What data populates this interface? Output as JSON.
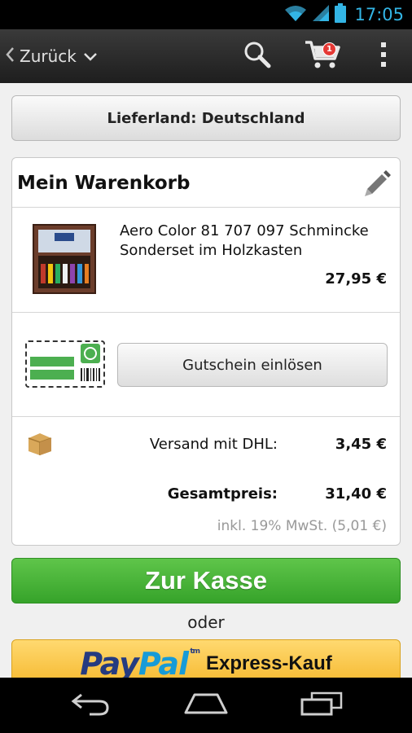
{
  "status_bar": {
    "time": "17:05"
  },
  "action_bar": {
    "back_label": "Zurück",
    "cart_count": "1"
  },
  "country": {
    "label": "Lieferland: Deutschland"
  },
  "cart": {
    "title": "Mein Warenkorb",
    "item": {
      "name": "Aero Color 81 707 097 Schmincke Sonderset im Holzkasten",
      "price": "27,95 €"
    },
    "voucher_label": "Gutschein einlösen",
    "shipping_label": "Versand mit DHL:",
    "shipping_price": "3,45 €",
    "total_label": "Gesamtpreis:",
    "total_price": "31,40 €",
    "vat_note": "inkl. 19% MwSt. (5,01 €)"
  },
  "checkout": {
    "label": "Zur Kasse",
    "or_label": "oder"
  },
  "paypal": {
    "pay": "Pay",
    "pal": "Pal",
    "tm": "tm",
    "express_label": "Express-Kauf"
  },
  "colors": {
    "accent_blue": "#33b5e5",
    "checkout_green": "#3fae2e",
    "paypal_yellow": "#f7c04a"
  },
  "icons": [
    "wifi-icon",
    "signal-icon",
    "battery-icon",
    "chevron-left-icon",
    "chevron-down-icon",
    "search-icon",
    "cart-icon",
    "overflow-menu-icon",
    "pencil-icon",
    "package-icon",
    "back-nav-icon",
    "home-nav-icon",
    "recents-nav-icon"
  ]
}
